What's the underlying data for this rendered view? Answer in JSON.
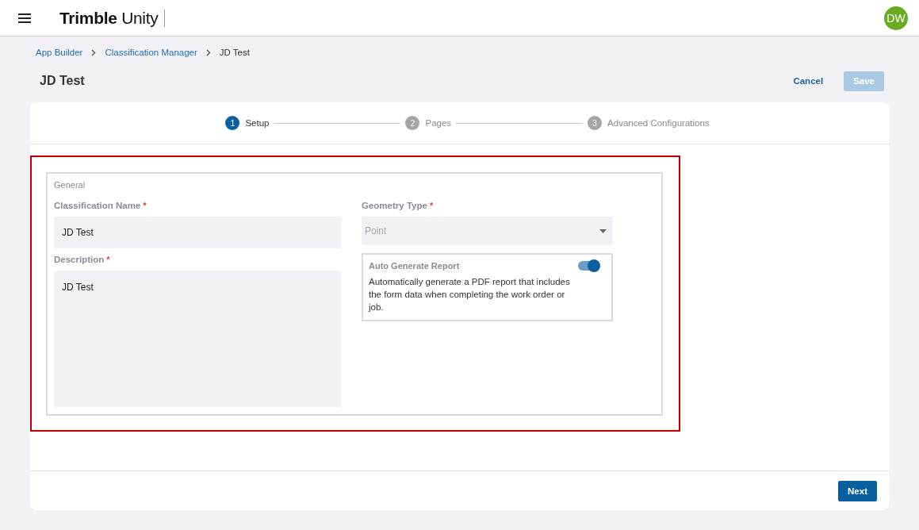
{
  "header": {
    "logo": "**Trimble** Unity",
    "avatar": "DW"
  },
  "breadcrumbs": [
    {
      "label": "App Builder",
      "link": true
    },
    {
      "label": "Classification Manager",
      "link": true
    },
    {
      "label": "JD Test",
      "link": false
    }
  ],
  "page": {
    "title": "JD Test",
    "actions": [
      {
        "label": "Cancel",
        "kind": "link"
      },
      {
        "label": "Save",
        "kind": "primary",
        "disabled": true
      }
    ]
  },
  "steps": [
    {
      "number": "1",
      "label": "Setup",
      "selected": true
    },
    {
      "number": "2",
      "label": "Pages",
      "selected": false
    },
    {
      "number": "3",
      "label": "Advanced Configurations",
      "selected": false
    }
  ],
  "form": {
    "section": "General",
    "highlighted": true,
    "classification_name": {
      "label": "Classification Name",
      "required_mark": "*",
      "value": "JD Test"
    },
    "description": {
      "label": "Description",
      "required_mark": "*",
      "value": "JD Test"
    },
    "geometry_type": {
      "label": "Geometry Type",
      "required_mark": "*",
      "value": "Point",
      "disabled": true
    },
    "auto_report": {
      "title": "Auto Generate Report",
      "text": "Automatically generate a PDF report that includes the form data when completing the work order or job.",
      "on": true
    }
  },
  "footer": {
    "button": "Next"
  }
}
